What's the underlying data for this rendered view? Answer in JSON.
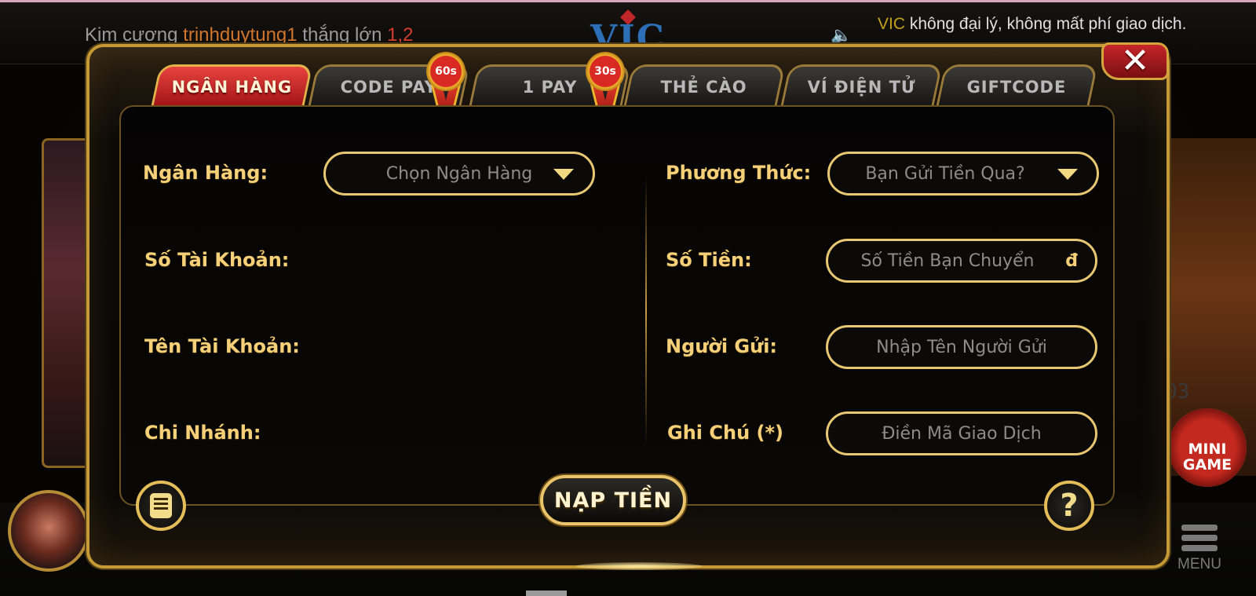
{
  "background": {
    "ticker": {
      "prefix": "Kim cương",
      "user": "trinhduytung1",
      "middle": "thắng lớn",
      "amount": "1,2"
    },
    "logo": "VIC",
    "notice": {
      "brand": "VIC",
      "text": "không đại lý, không mất phí giao dịch."
    },
    "right_number": "03",
    "minigame_label_1": "MINI",
    "minigame_label_2": "GAME",
    "menu_label": "MENU"
  },
  "modal": {
    "tabs": [
      {
        "label": "NGÂN HÀNG",
        "active": true
      },
      {
        "label": "CODE PAY",
        "active": false,
        "badge": "60s"
      },
      {
        "label": "1 PAY",
        "active": false,
        "badge": "30s"
      },
      {
        "label": "THẺ CÀO",
        "active": false
      },
      {
        "label": "VÍ ĐIỆN TỬ",
        "active": false
      },
      {
        "label": "GIFTCODE",
        "active": false
      }
    ],
    "left_form": {
      "bank_label": "Ngân Hàng:",
      "bank_select_value": "Chọn Ngân Hàng",
      "account_number_label": "Số Tài Khoản:",
      "account_name_label": "Tên Tài Khoản:",
      "branch_label": "Chi Nhánh:"
    },
    "right_form": {
      "method_label": "Phương Thức:",
      "method_select_value": "Bạn Gửi Tiền Qua?",
      "amount_label": "Số Tiền:",
      "amount_placeholder": "Số Tiền Bạn Chuyển",
      "currency_symbol": "đ",
      "sender_label": "Người Gửi:",
      "sender_placeholder": "Nhập Tên Người Gửi",
      "note_label": "Ghi Chú (*)",
      "note_placeholder": "Điền Mã Giao Dịch"
    },
    "submit_label": "NẠP TIỀN",
    "help_glyph": "?",
    "close_glyph": "✕"
  },
  "colors": {
    "gold": "#e8c772",
    "label_gold": "#f5d078",
    "active_tab_red": "#c41d1f",
    "panel_bg": "#0a0806"
  }
}
